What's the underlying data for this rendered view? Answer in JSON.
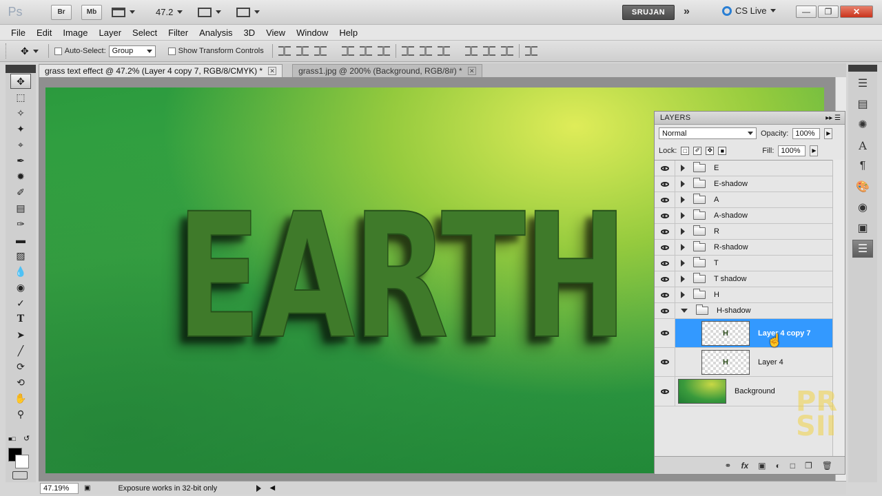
{
  "titlebar": {
    "app_logo": "Ps",
    "bridge_label": "Br",
    "minibridge_label": "Mb",
    "zoom_value": "47.2",
    "workspace_label": "SRUJAN",
    "cslive_label": "CS Live",
    "icons": {
      "arrange": "grid-arrange-icon",
      "screen_mode": "screen-mode-icon",
      "extra_layouts": "grid-icon"
    }
  },
  "menu": {
    "items": [
      "File",
      "Edit",
      "Image",
      "Layer",
      "Select",
      "Filter",
      "Analysis",
      "3D",
      "View",
      "Window",
      "Help"
    ]
  },
  "options": {
    "auto_select_label": "Auto-Select:",
    "auto_select_value": "Group",
    "show_transform_label": "Show Transform Controls"
  },
  "documents": {
    "tabs": [
      {
        "label": "grass text effect @ 47.2% (Layer 4 copy 7, RGB/8/CMYK) *",
        "active": true
      },
      {
        "label": "grass1.jpg @ 200% (Background, RGB/8#) *",
        "active": false
      }
    ]
  },
  "canvas": {
    "text": "EARTH",
    "colors": {
      "grass_dark": "#2b9a3e",
      "grass_light": "#d8e85a",
      "letters": "#3f7a2a"
    }
  },
  "status": {
    "zoom": "47.19%",
    "info": "Exposure works in 32-bit only"
  },
  "layers_panel": {
    "title": "LAYERS",
    "blend_mode": "Normal",
    "opacity_label": "Opacity:",
    "opacity_value": "100%",
    "lock_label": "Lock:",
    "fill_label": "Fill:",
    "fill_value": "100%",
    "layers": [
      {
        "name": "E",
        "type": "group",
        "expanded": false
      },
      {
        "name": "E-shadow",
        "type": "group",
        "expanded": false
      },
      {
        "name": "A",
        "type": "group",
        "expanded": false
      },
      {
        "name": "A-shadow",
        "type": "group",
        "expanded": false
      },
      {
        "name": "R",
        "type": "group",
        "expanded": false
      },
      {
        "name": "R-shadow",
        "type": "group",
        "expanded": false
      },
      {
        "name": "T",
        "type": "group",
        "expanded": false
      },
      {
        "name": "T shadow",
        "type": "group",
        "expanded": false
      },
      {
        "name": "H",
        "type": "group",
        "expanded": false
      },
      {
        "name": "H-shadow",
        "type": "group",
        "expanded": true
      },
      {
        "name": "Layer 4 copy 7",
        "type": "layer",
        "selected": true,
        "thumb": "H"
      },
      {
        "name": "Layer 4",
        "type": "layer",
        "selected": false,
        "thumb": "H"
      },
      {
        "name": "Background",
        "type": "background",
        "selected": false
      }
    ],
    "selection_color": "#3399ff"
  }
}
